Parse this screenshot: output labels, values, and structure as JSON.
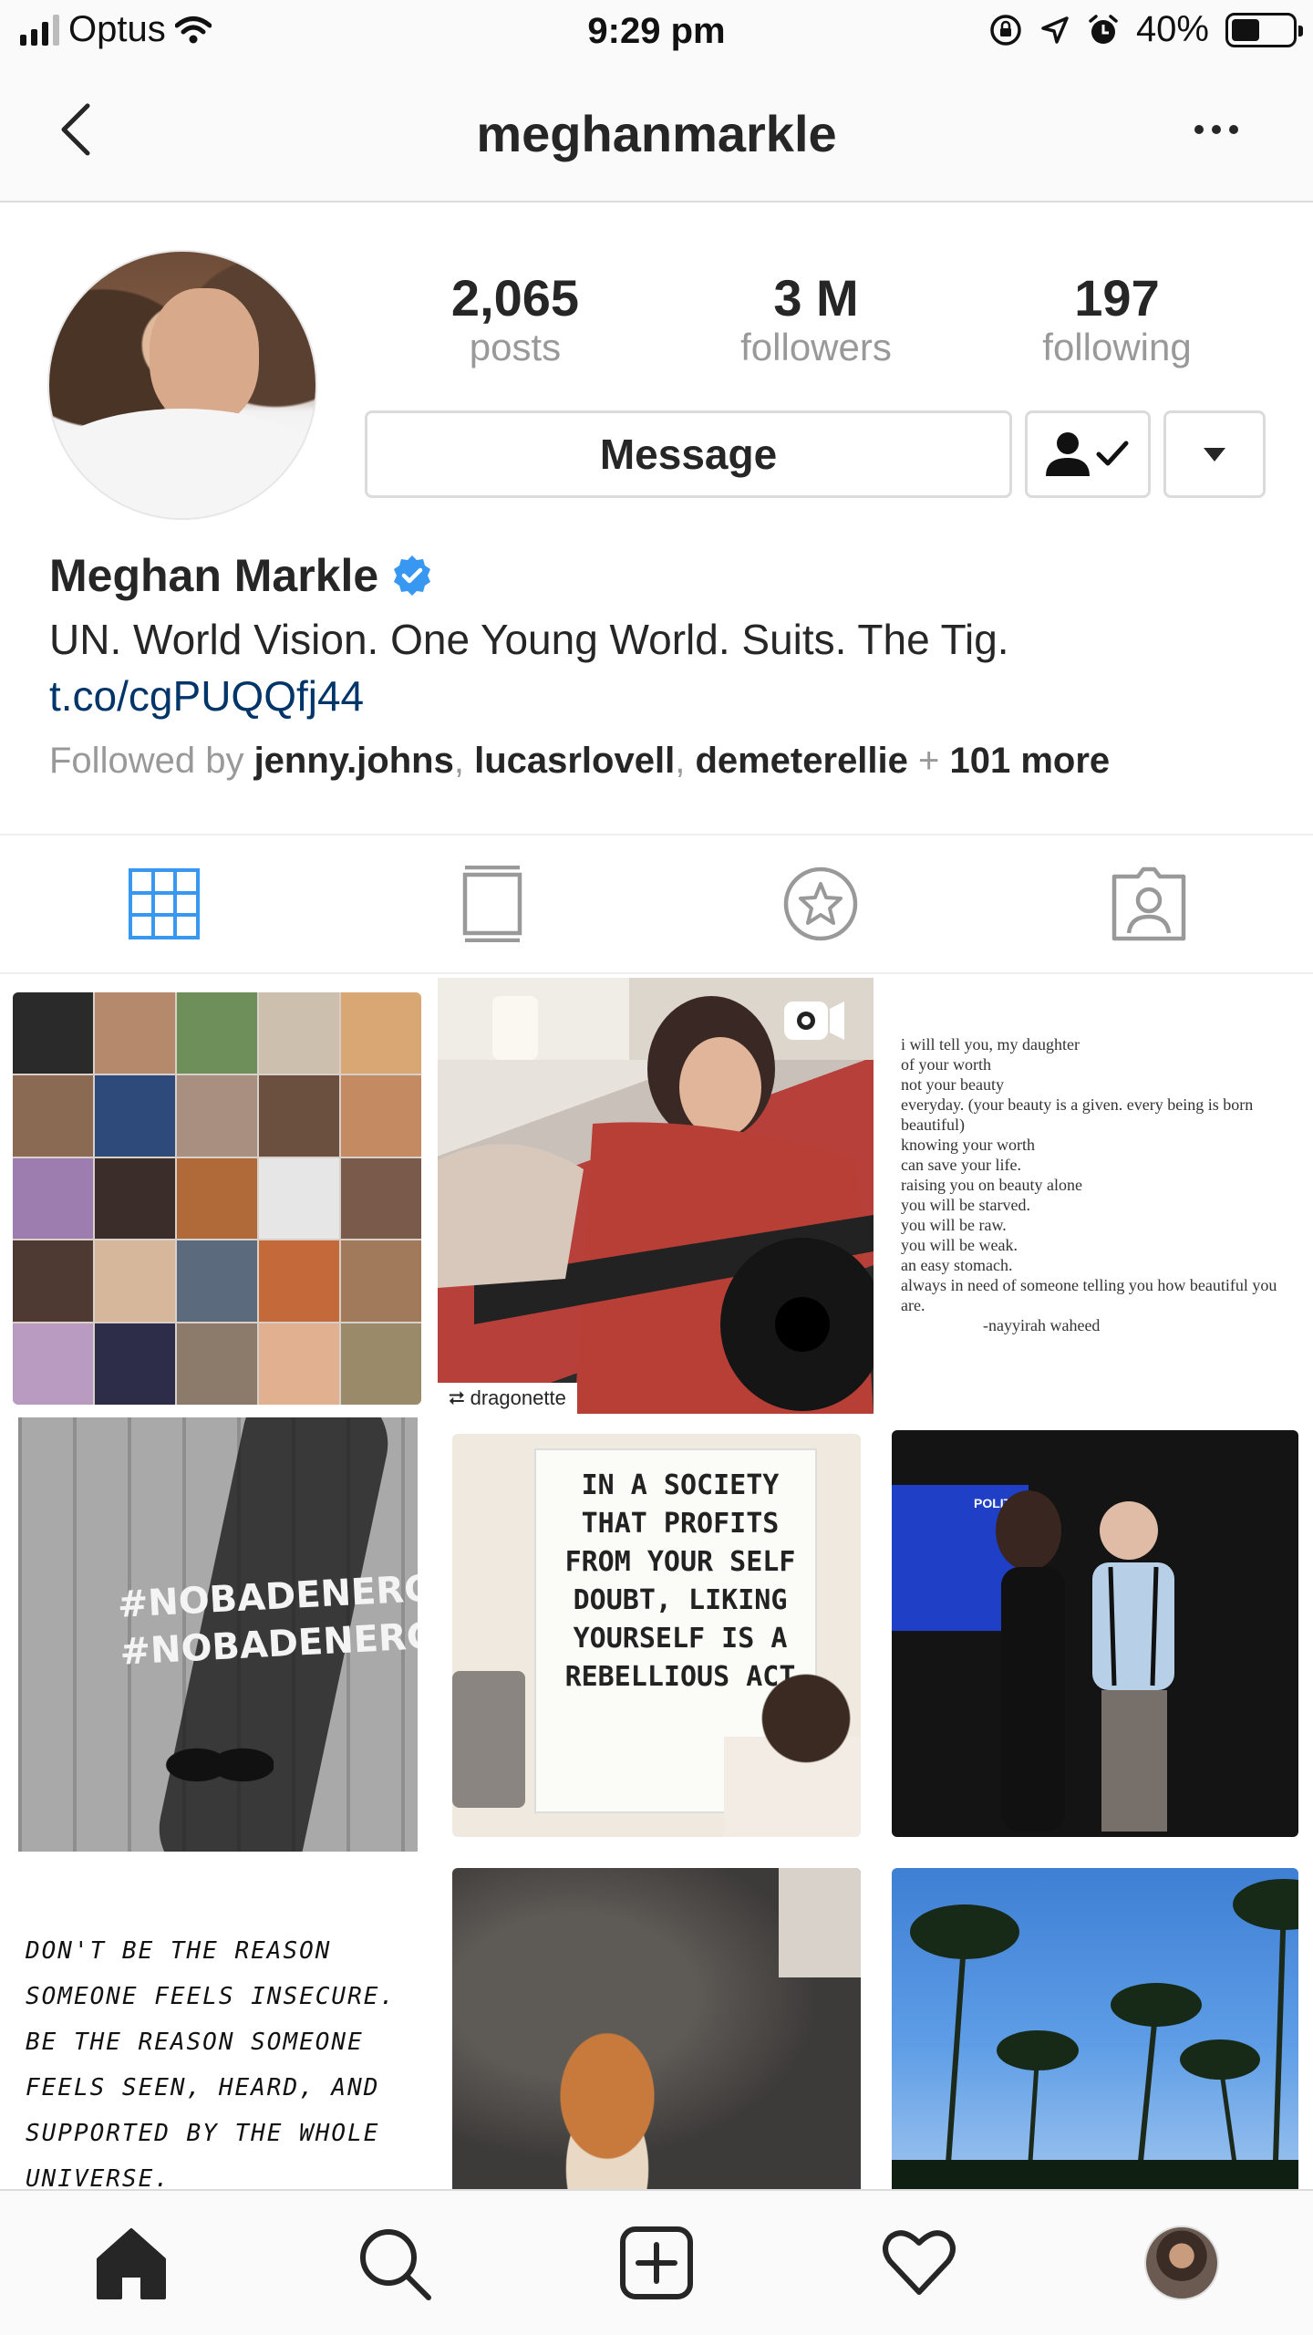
{
  "status_bar": {
    "carrier": "Optus",
    "time": "9:29 pm",
    "battery": "40%"
  },
  "header": {
    "title": "meghanmarkle"
  },
  "profile": {
    "stats": [
      {
        "count": "2,065",
        "label": "posts"
      },
      {
        "count": "3 M",
        "label": "followers"
      },
      {
        "count": "197",
        "label": "following"
      }
    ],
    "message_label": "Message",
    "full_name": "Meghan Markle",
    "bio": "UN. World Vision. One Young World. Suits. The Tig.",
    "link": "t.co/cgPUQQfj44",
    "followed_by": {
      "prefix": "Followed by",
      "users": [
        "jenny.johns",
        "lucasrlovell",
        "demeterellie"
      ],
      "more": "101 more"
    }
  },
  "tabs": [
    {
      "icon": "grid-icon",
      "active": true
    },
    {
      "icon": "list-icon",
      "active": false
    },
    {
      "icon": "star-icon",
      "active": false
    },
    {
      "icon": "tagged-icon",
      "active": false
    }
  ],
  "posts": {
    "repost_user": "dragonette",
    "poem": "i will tell you, my daughter\nof your worth\nnot your beauty\neveryday. (your beauty is a given. every being is born\nbeautiful)\nknowing your worth\ncan save your life.\nraising you on beauty alone\nyou will be starved.\nyou will be raw.\nyou will be weak.\nan easy stomach.\nalways in need of someone telling you how beautiful you\nare.\n                    -nayyirah waheed",
    "hashtag_1": "#NOBADENERGY",
    "hashtag_2": "#NOBADENERGY",
    "sign_text": "IN A SOCIETY THAT PROFITS FROM YOUR SELF DOUBT, LIKING YOURSELF IS A REBELLIOUS ACT",
    "screen_text": "POLITIC",
    "handwritten": "DON'T BE THE REASON SOMEONE FEELS INSECURE. BE THE REASON SOMEONE FEELS SEEN, HEARD, AND SUPPORTED BY THE WHOLE UNIVERSE."
  },
  "bottom_nav": [
    {
      "icon": "home-icon"
    },
    {
      "icon": "search-icon"
    },
    {
      "icon": "add-post-icon"
    },
    {
      "icon": "heart-icon"
    },
    {
      "icon": "profile-avatar"
    }
  ],
  "colors": {
    "active_tab": "#3897f0",
    "link": "#003569",
    "verified": "#3897f0",
    "secondary_text": "#999999"
  }
}
